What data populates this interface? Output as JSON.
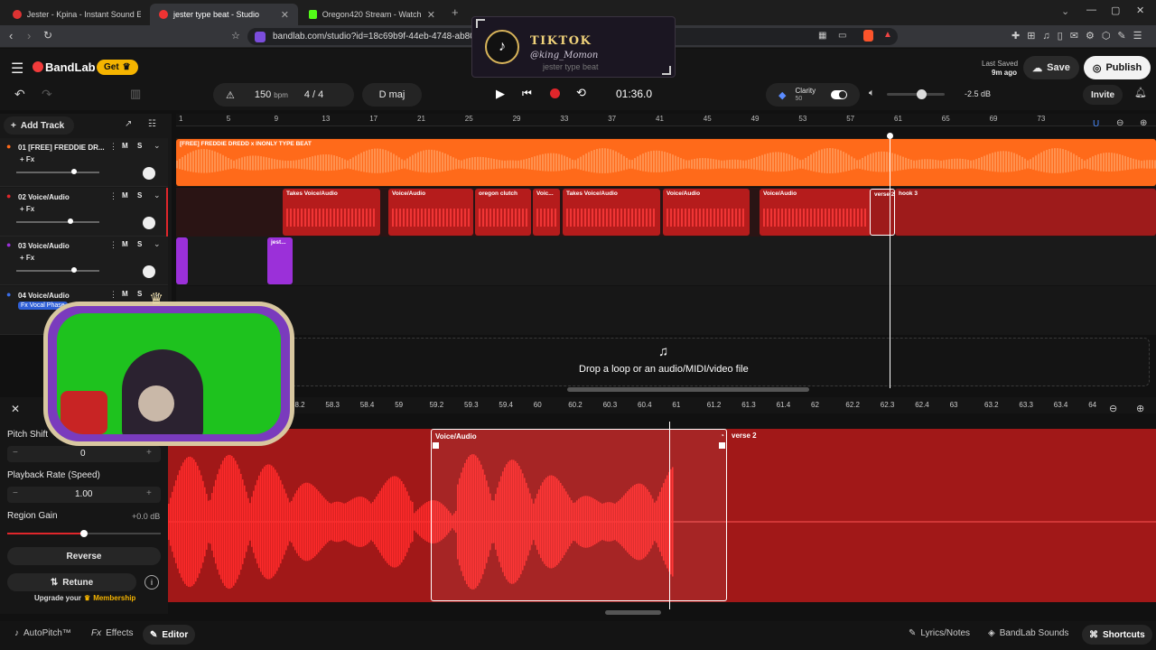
{
  "browser": {
    "tabs": [
      {
        "title": "Jester - Kpina - Instant Sound Effect B",
        "color": "#d33"
      },
      {
        "title": "jester type beat - Studio",
        "color": "#e33"
      },
      {
        "title": "Oregon420 Stream - Watch Live on Ki",
        "color": "#53fc18"
      }
    ],
    "url": "bandlab.com/studio?id=18c69b9f-44eb-4748-ab80-73"
  },
  "overlay": {
    "platform": "TIKTOK",
    "handle": "@king_Momon",
    "subtitle": "jester type beat"
  },
  "header": {
    "brand": "BandLab",
    "get_label": "Get",
    "last_saved_label": "Last Saved",
    "last_saved_time": "9m ago",
    "save_label": "Save",
    "publish_label": "Publish"
  },
  "transport": {
    "bpm": "150",
    "bpm_unit": "bpm",
    "time_sig_num": "4",
    "time_sig_sep": "/",
    "time_sig_den": "4",
    "key": "D maj",
    "time": "01:36.0",
    "clarity_label": "Clarity",
    "clarity_value": "50",
    "volume_db": "-2.5 dB",
    "invite_label": "Invite"
  },
  "sidebar": {
    "add_track_label": "Add Track",
    "tracks": [
      {
        "num": "01",
        "name": "[FREE] FREDDIE DR...",
        "fx": "+ Fx",
        "m": "M",
        "s": "S",
        "color": "#ff6a1a",
        "level": 0.7
      },
      {
        "num": "02",
        "name": "Voice/Audio",
        "fx": "+ Fx",
        "m": "M",
        "s": "S",
        "color": "#e0262b",
        "level": 0.65
      },
      {
        "num": "03",
        "name": "Voice/Audio",
        "fx": "+ Fx",
        "m": "M",
        "s": "S",
        "color": "#9b30d9",
        "level": 0.7
      },
      {
        "num": "04",
        "name": "Voice/Audio",
        "fx": "Fx Vocal Phase",
        "m": "M",
        "s": "S",
        "color": "#3a6ee8",
        "level": 0.7
      }
    ]
  },
  "ruler": {
    "bars": [
      "1",
      "5",
      "9",
      "13",
      "17",
      "21",
      "25",
      "29",
      "33",
      "37",
      "41",
      "45",
      "49",
      "53",
      "57",
      "61",
      "65",
      "69",
      "73"
    ]
  },
  "lanes": {
    "track1_title": "[FREE] FREDDIE DREDD x INONLY TYPE BEAT",
    "track2_clips": [
      {
        "label": "Takes   Voice/Audio"
      },
      {
        "label": "Voice/Audio"
      },
      {
        "label": "oregon clutch"
      },
      {
        "label": "Voic..."
      },
      {
        "label": "Takes   Voice/Audio"
      },
      {
        "label": "Voice/Audio"
      },
      {
        "label": "Voice/Audio"
      },
      {
        "label": "verse 2"
      },
      {
        "label": "hook 3"
      }
    ],
    "track3_clip": "jest...",
    "drop_hint": "Drop a loop or an audio/MIDI/video file"
  },
  "editor": {
    "ticks": [
      "58.2",
      "58.3",
      "58.4",
      "59",
      "59.2",
      "59.3",
      "59.4",
      "60",
      "60.2",
      "60.3",
      "60.4",
      "61",
      "61.2",
      "61.3",
      "61.4",
      "62",
      "62.2",
      "62.3",
      "62.4",
      "63",
      "63.2",
      "63.3",
      "63.4",
      "64"
    ],
    "region_label": "Voice/Audio",
    "next_label": "verse 2"
  },
  "panel": {
    "pitch_label": "Pitch Shift",
    "pitch_value": "0",
    "rate_label": "Playback Rate (Speed)",
    "rate_value": "1.00",
    "gain_label": "Region Gain",
    "gain_value": "+0.0 dB",
    "gain_level": 0.5,
    "reverse_label": "Reverse",
    "retune_label": "Retune",
    "upgrade_text": "Upgrade your",
    "membership_text": "Membership"
  },
  "bottom": {
    "autopitch": "AutoPitch™",
    "effects": "Effects",
    "editor": "Editor",
    "lyrics": "Lyrics/Notes",
    "sounds": "BandLab Sounds",
    "shortcuts": "Shortcuts"
  },
  "colors": {
    "orange": "#ff6a1a",
    "red": "#e0262b",
    "purple": "#9b30d9",
    "accent_gold": "#f5b400"
  }
}
